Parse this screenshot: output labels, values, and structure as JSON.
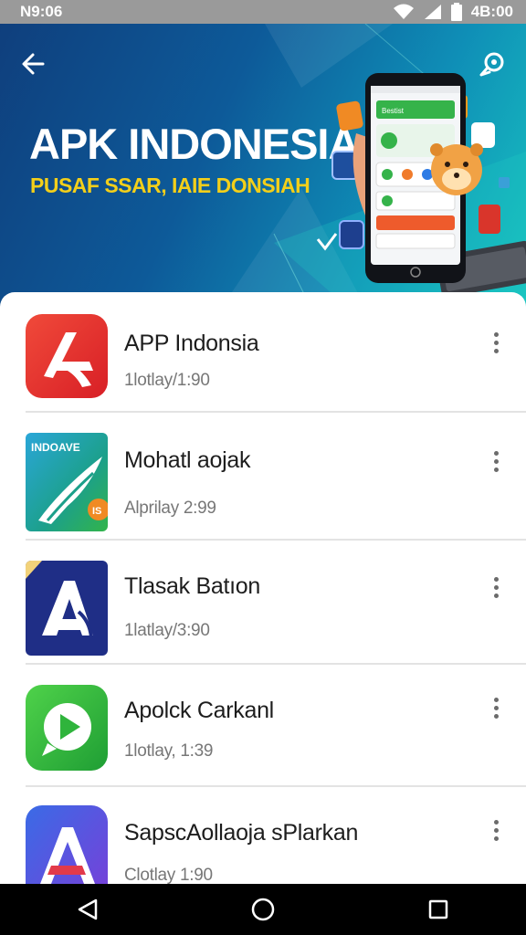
{
  "status_bar": {
    "time": "N9:06",
    "clock_right": "4B:00",
    "icons": [
      "wifi-icon",
      "signal-icon",
      "battery-icon"
    ]
  },
  "banner": {
    "title": "APK INDONESIA",
    "subtitle": "PUSAF SSAR, IAIE DONSIAH",
    "phone_screen_label": "Bestist",
    "colors": {
      "background_start": "#0f3f7d",
      "background_end": "#18c3c0",
      "subtitle": "#f3cf1a"
    },
    "icons": [
      "back-arrow-icon",
      "share-icon"
    ]
  },
  "apps": [
    {
      "name": "APP Indonsia",
      "meta": "1lotlay/1:90",
      "icon": "app-a-red-icon",
      "badge_text": ""
    },
    {
      "name": "Mohatl aojak",
      "meta": "Alprilay 2:99",
      "icon": "indoave-icon",
      "icon_label": "INDOAVE",
      "badge_text": "IS"
    },
    {
      "name": "Tlasak Batıon",
      "meta": "1latlay/3:90",
      "icon": "app-a-navy-icon",
      "badge_text": ""
    },
    {
      "name": "Apolck Carkanl",
      "meta": "1lotlay, 1:39",
      "icon": "play-chat-icon",
      "badge_text": ""
    },
    {
      "name": "SapscAollaoja sPlarkan",
      "meta": "Clotlay 1:90",
      "icon": "app-a-purple-icon",
      "badge_text": ""
    }
  ],
  "nav": {
    "icons": [
      "back-triangle-icon",
      "home-circle-icon",
      "recents-square-icon"
    ]
  }
}
